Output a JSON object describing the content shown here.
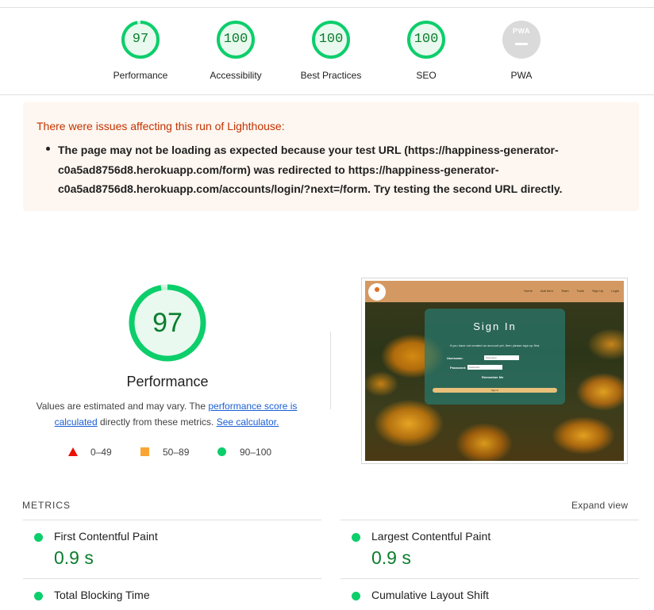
{
  "categories": [
    {
      "score": "97",
      "label": "Performance",
      "color": "#0cce6b"
    },
    {
      "score": "100",
      "label": "Accessibility",
      "color": "#0cce6b"
    },
    {
      "score": "100",
      "label": "Best Practices",
      "color": "#0cce6b"
    },
    {
      "score": "100",
      "label": "SEO",
      "color": "#0cce6b"
    },
    {
      "badge": "PWA",
      "label": "PWA",
      "color": "#dadada"
    }
  ],
  "warning": {
    "title": "There were issues affecting this run of Lighthouse:",
    "items": [
      "The page may not be loading as expected because your test URL (https://happiness-generator-c0a5ad8756d8.herokuapp.com/form) was redirected to https://happiness-generator-c0a5ad8756d8.herokuapp.com/accounts/login/?next=/form. Try testing the second URL directly."
    ]
  },
  "performance": {
    "score": "97",
    "title": "Performance",
    "desc_before": "Values are estimated and may vary. The ",
    "desc_link1": "performance score is calculated",
    "desc_middle": " directly from these metrics. ",
    "desc_link2": "See calculator."
  },
  "legend": [
    {
      "shape": "triangle",
      "range": "0–49",
      "color": "#eb0f00"
    },
    {
      "shape": "square",
      "range": "50–89",
      "color": "#f9a534"
    },
    {
      "shape": "circle",
      "range": "90–100",
      "color": "#0cce6b"
    }
  ],
  "screenshot": {
    "nav_links": [
      "Home",
      "Add Item",
      "Team",
      "Tools",
      "Sign Up",
      "Login"
    ],
    "card_title": "Sign In",
    "card_subtitle": "If you have not created an account yet, then please sign up first.",
    "username_label": "Username:",
    "username_placeholder": "Username",
    "password_label": "Password:",
    "password_placeholder": "Password",
    "remember_label": "Remember Me",
    "button_label": "Sign In"
  },
  "metrics": {
    "header": "METRICS",
    "expand_label": "Expand view",
    "items": [
      {
        "name": "First Contentful Paint",
        "value": "0.9 s",
        "status": "good"
      },
      {
        "name": "Largest Contentful Paint",
        "value": "0.9 s",
        "status": "good"
      },
      {
        "name": "Total Blocking Time",
        "value": "",
        "status": "good"
      },
      {
        "name": "Cumulative Layout Shift",
        "value": "",
        "status": "good"
      }
    ]
  },
  "colors": {
    "pass": "#0cce6b",
    "pass_text": "#0a7d2c",
    "warning_bg": "#fef6f0",
    "warning_text": "#c33300"
  }
}
